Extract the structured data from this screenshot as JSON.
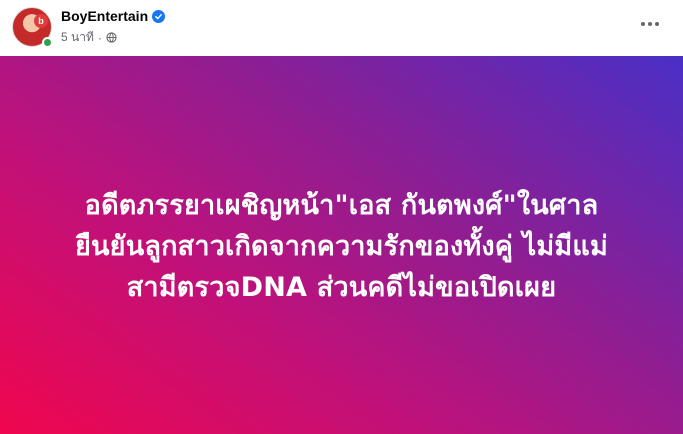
{
  "post": {
    "author_name": "BoyEntertain",
    "avatar_badge": "b",
    "time": "5 นาที",
    "separator": "·",
    "verified": true,
    "privacy_icon": "globe-icon",
    "more_icon": "more-dots-icon"
  },
  "banner": {
    "lines": [
      "อดีตภรรยาเผชิญหน้า\"เอส กันตพงศ์\"ในศาล",
      "ยืนยันลูกสาวเกิดจากความรักของทั้งคู่ ไม่มีแม่",
      "สามีตรวจDNA ส่วนคดีไม่ขอเปิดเผย"
    ],
    "colors": {
      "start": "#f0064e",
      "mid": "#8a1f95",
      "end": "#4a2fc6"
    }
  },
  "colors": {
    "online": "#31a24c",
    "verified": "#1877f2"
  }
}
